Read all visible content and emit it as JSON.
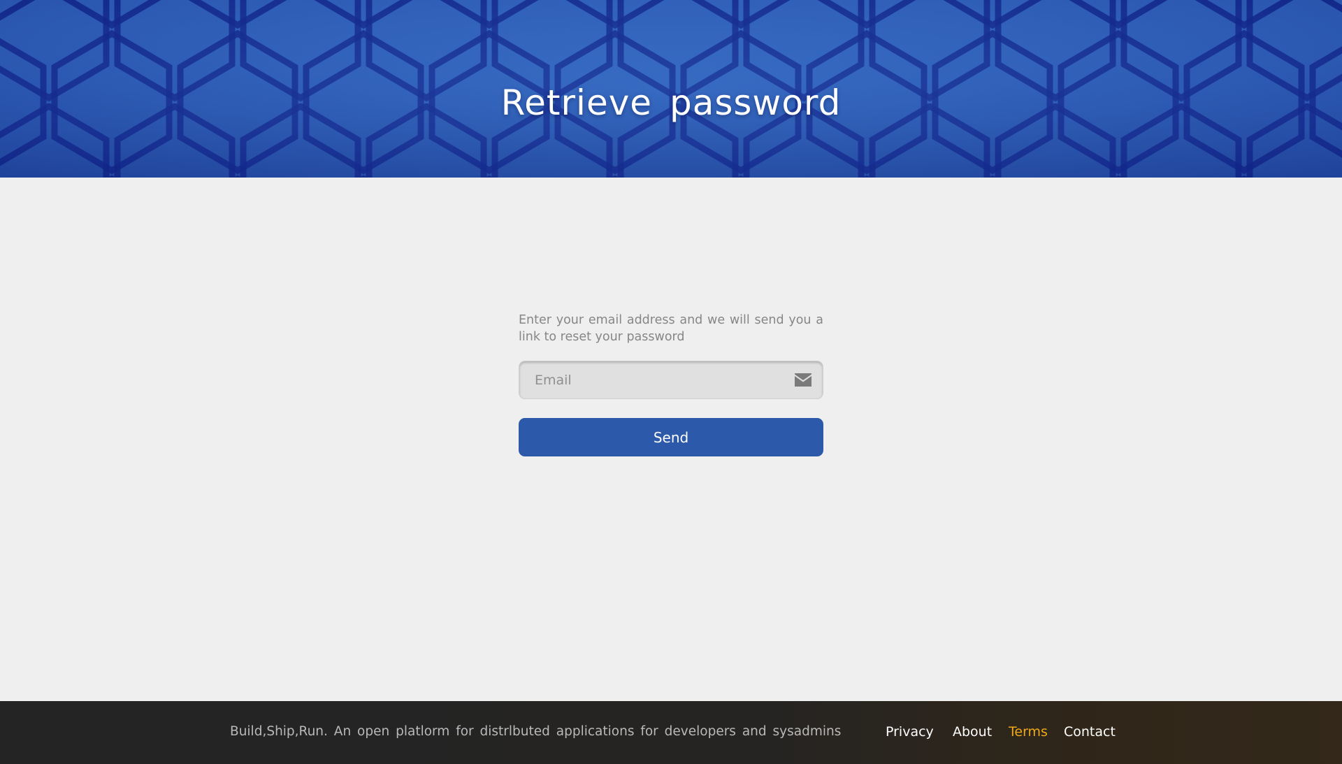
{
  "hero": {
    "title": "Retrieve password",
    "background_colors": [
      "#3a72c9",
      "#2a55ab",
      "#0f2a8a"
    ]
  },
  "form": {
    "description": "Enter your email address and we will send you a link to reset your password",
    "email": {
      "placeholder": "Email",
      "value": "",
      "icon": "envelope-icon"
    },
    "send_label": "Send",
    "send_color": "#2c59a9"
  },
  "footer": {
    "tagline": "Build,Ship,Run. An open platlorm for distrlbuted applications for developers and sysadmins",
    "links": [
      {
        "label": "Privacy",
        "active": false
      },
      {
        "label": "About",
        "active": false
      },
      {
        "label": "Terms",
        "active": true
      },
      {
        "label": "Contact",
        "active": false
      }
    ],
    "active_color": "#f0a91b"
  }
}
